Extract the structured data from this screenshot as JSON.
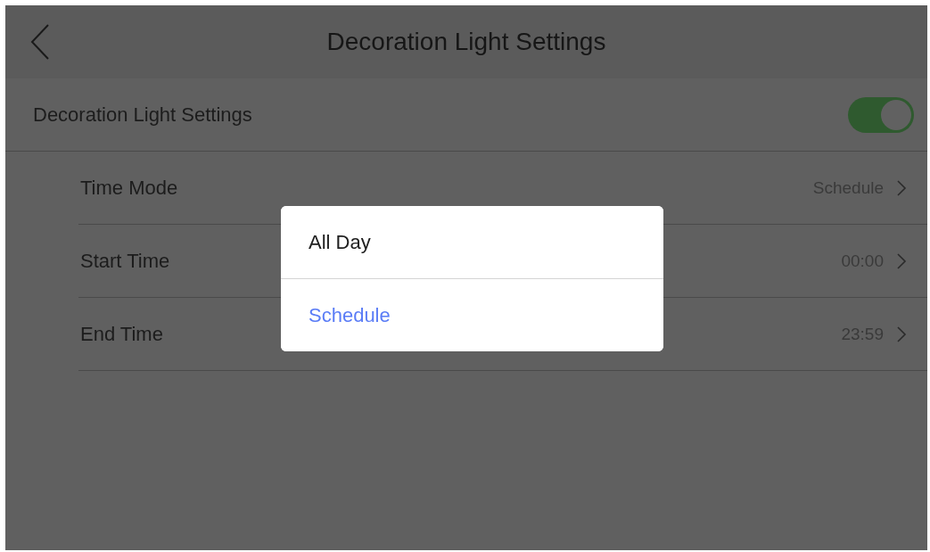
{
  "header": {
    "title": "Decoration Light Settings"
  },
  "master": {
    "label": "Decoration Light Settings",
    "on": true
  },
  "rows": [
    {
      "label": "Time Mode",
      "value": "Schedule"
    },
    {
      "label": "Start Time",
      "value": "00:00"
    },
    {
      "label": "End Time",
      "value": "23:59"
    }
  ],
  "dialog": {
    "options": [
      {
        "label": "All Day",
        "selected": false
      },
      {
        "label": "Schedule",
        "selected": true
      }
    ]
  }
}
